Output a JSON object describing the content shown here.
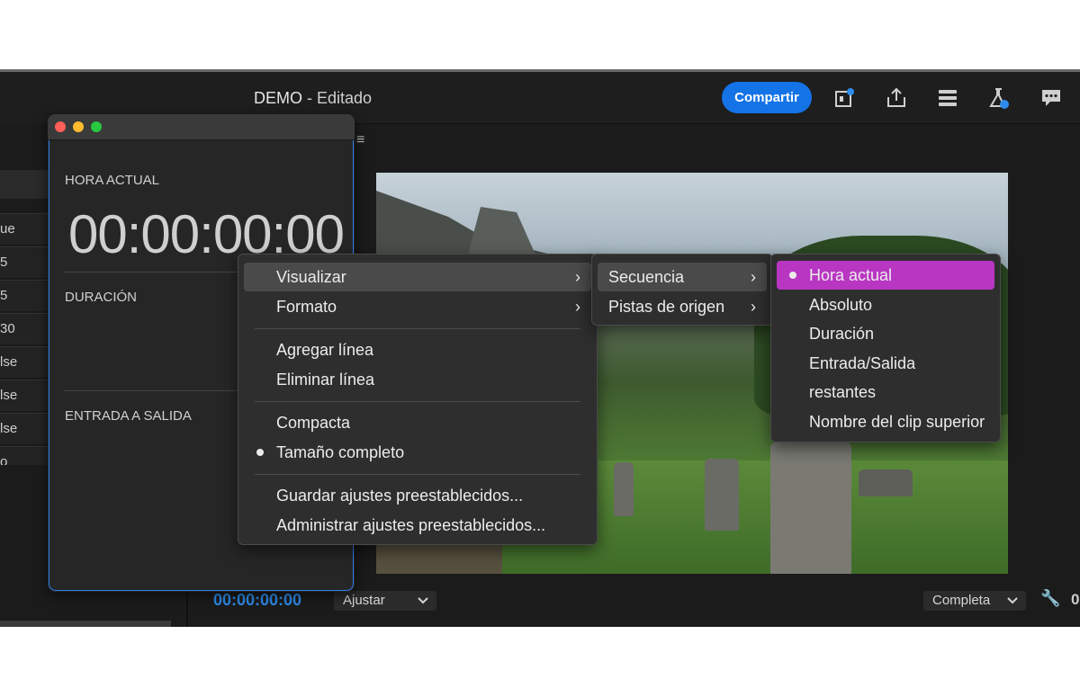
{
  "header": {
    "doc_name": "DEMO",
    "doc_status": " - Editado",
    "share_label": "Compartir",
    "icons": [
      "quick-export-icon",
      "export-icon",
      "workspaces-icon",
      "beta-flask-icon",
      "feedback-icon"
    ]
  },
  "left_strip": {
    "rows": [
      "ue",
      "5",
      "5",
      "30",
      "lse",
      "lse",
      "lse",
      "o"
    ]
  },
  "timecode_window": {
    "section1_label": "HORA ACTUAL",
    "current_time": "00:00:00:00",
    "section2_label": "DURACIÓN",
    "section3_label": "ENTRADA A SALIDA"
  },
  "monitor": {
    "playhead_time": "00:00:00:00",
    "fit_label": "Ajustar",
    "quality_label": "Completa",
    "cut_value": "0"
  },
  "context_menu": {
    "items": [
      {
        "label": "Visualizar",
        "submenu": true,
        "highlighted": true
      },
      {
        "label": "Formato",
        "submenu": true
      },
      {
        "label": "Agregar línea"
      },
      {
        "label": "Eliminar línea"
      },
      {
        "label": "Compacta"
      },
      {
        "label": "Tamaño completo",
        "checked": true
      },
      {
        "label": "Guardar ajustes preestablecidos..."
      },
      {
        "label": "Administrar ajustes preestablecidos..."
      }
    ]
  },
  "submenu_visualizar": {
    "items": [
      {
        "label": "Secuencia",
        "submenu": true,
        "highlighted": true
      },
      {
        "label": "Pistas de origen",
        "submenu": true
      }
    ]
  },
  "submenu_secuencia": {
    "items": [
      {
        "label": "Hora actual",
        "checked": true,
        "selected": true
      },
      {
        "label": "Absoluto"
      },
      {
        "label": "Duración"
      },
      {
        "label": "Entrada/Salida"
      },
      {
        "label": "restantes"
      },
      {
        "label": "Nombre del clip superior"
      }
    ]
  },
  "colors": {
    "accent_blue": "#1473e6",
    "selection_magenta": "#b936c2",
    "timecode_blue": "#2d8ceb"
  }
}
